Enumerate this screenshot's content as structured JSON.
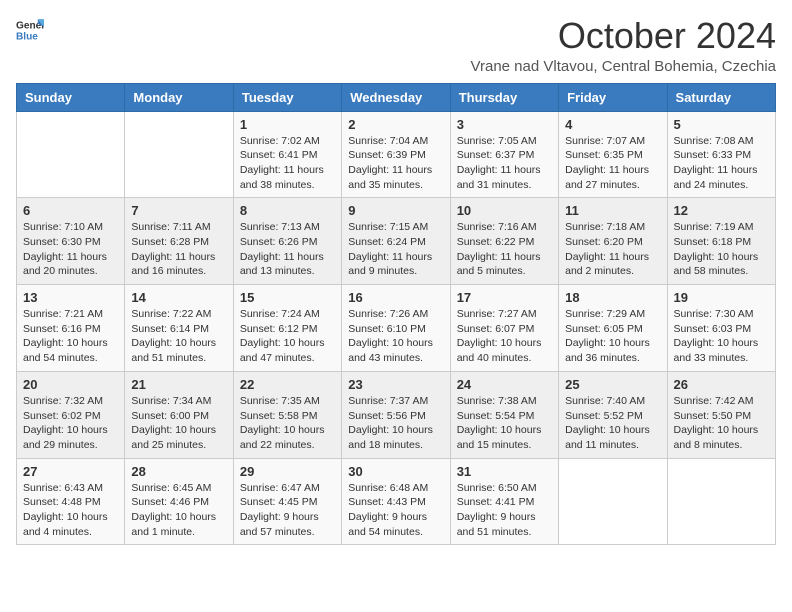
{
  "header": {
    "logo_general": "General",
    "logo_blue": "Blue",
    "month_title": "October 2024",
    "location": "Vrane nad Vltavou, Central Bohemia, Czechia"
  },
  "weekdays": [
    "Sunday",
    "Monday",
    "Tuesday",
    "Wednesday",
    "Thursday",
    "Friday",
    "Saturday"
  ],
  "weeks": [
    [
      {
        "day": "",
        "info": ""
      },
      {
        "day": "",
        "info": ""
      },
      {
        "day": "1",
        "info": "Sunrise: 7:02 AM\nSunset: 6:41 PM\nDaylight: 11 hours and 38 minutes."
      },
      {
        "day": "2",
        "info": "Sunrise: 7:04 AM\nSunset: 6:39 PM\nDaylight: 11 hours and 35 minutes."
      },
      {
        "day": "3",
        "info": "Sunrise: 7:05 AM\nSunset: 6:37 PM\nDaylight: 11 hours and 31 minutes."
      },
      {
        "day": "4",
        "info": "Sunrise: 7:07 AM\nSunset: 6:35 PM\nDaylight: 11 hours and 27 minutes."
      },
      {
        "day": "5",
        "info": "Sunrise: 7:08 AM\nSunset: 6:33 PM\nDaylight: 11 hours and 24 minutes."
      }
    ],
    [
      {
        "day": "6",
        "info": "Sunrise: 7:10 AM\nSunset: 6:30 PM\nDaylight: 11 hours and 20 minutes."
      },
      {
        "day": "7",
        "info": "Sunrise: 7:11 AM\nSunset: 6:28 PM\nDaylight: 11 hours and 16 minutes."
      },
      {
        "day": "8",
        "info": "Sunrise: 7:13 AM\nSunset: 6:26 PM\nDaylight: 11 hours and 13 minutes."
      },
      {
        "day": "9",
        "info": "Sunrise: 7:15 AM\nSunset: 6:24 PM\nDaylight: 11 hours and 9 minutes."
      },
      {
        "day": "10",
        "info": "Sunrise: 7:16 AM\nSunset: 6:22 PM\nDaylight: 11 hours and 5 minutes."
      },
      {
        "day": "11",
        "info": "Sunrise: 7:18 AM\nSunset: 6:20 PM\nDaylight: 11 hours and 2 minutes."
      },
      {
        "day": "12",
        "info": "Sunrise: 7:19 AM\nSunset: 6:18 PM\nDaylight: 10 hours and 58 minutes."
      }
    ],
    [
      {
        "day": "13",
        "info": "Sunrise: 7:21 AM\nSunset: 6:16 PM\nDaylight: 10 hours and 54 minutes."
      },
      {
        "day": "14",
        "info": "Sunrise: 7:22 AM\nSunset: 6:14 PM\nDaylight: 10 hours and 51 minutes."
      },
      {
        "day": "15",
        "info": "Sunrise: 7:24 AM\nSunset: 6:12 PM\nDaylight: 10 hours and 47 minutes."
      },
      {
        "day": "16",
        "info": "Sunrise: 7:26 AM\nSunset: 6:10 PM\nDaylight: 10 hours and 43 minutes."
      },
      {
        "day": "17",
        "info": "Sunrise: 7:27 AM\nSunset: 6:07 PM\nDaylight: 10 hours and 40 minutes."
      },
      {
        "day": "18",
        "info": "Sunrise: 7:29 AM\nSunset: 6:05 PM\nDaylight: 10 hours and 36 minutes."
      },
      {
        "day": "19",
        "info": "Sunrise: 7:30 AM\nSunset: 6:03 PM\nDaylight: 10 hours and 33 minutes."
      }
    ],
    [
      {
        "day": "20",
        "info": "Sunrise: 7:32 AM\nSunset: 6:02 PM\nDaylight: 10 hours and 29 minutes."
      },
      {
        "day": "21",
        "info": "Sunrise: 7:34 AM\nSunset: 6:00 PM\nDaylight: 10 hours and 25 minutes."
      },
      {
        "day": "22",
        "info": "Sunrise: 7:35 AM\nSunset: 5:58 PM\nDaylight: 10 hours and 22 minutes."
      },
      {
        "day": "23",
        "info": "Sunrise: 7:37 AM\nSunset: 5:56 PM\nDaylight: 10 hours and 18 minutes."
      },
      {
        "day": "24",
        "info": "Sunrise: 7:38 AM\nSunset: 5:54 PM\nDaylight: 10 hours and 15 minutes."
      },
      {
        "day": "25",
        "info": "Sunrise: 7:40 AM\nSunset: 5:52 PM\nDaylight: 10 hours and 11 minutes."
      },
      {
        "day": "26",
        "info": "Sunrise: 7:42 AM\nSunset: 5:50 PM\nDaylight: 10 hours and 8 minutes."
      }
    ],
    [
      {
        "day": "27",
        "info": "Sunrise: 6:43 AM\nSunset: 4:48 PM\nDaylight: 10 hours and 4 minutes."
      },
      {
        "day": "28",
        "info": "Sunrise: 6:45 AM\nSunset: 4:46 PM\nDaylight: 10 hours and 1 minute."
      },
      {
        "day": "29",
        "info": "Sunrise: 6:47 AM\nSunset: 4:45 PM\nDaylight: 9 hours and 57 minutes."
      },
      {
        "day": "30",
        "info": "Sunrise: 6:48 AM\nSunset: 4:43 PM\nDaylight: 9 hours and 54 minutes."
      },
      {
        "day": "31",
        "info": "Sunrise: 6:50 AM\nSunset: 4:41 PM\nDaylight: 9 hours and 51 minutes."
      },
      {
        "day": "",
        "info": ""
      },
      {
        "day": "",
        "info": ""
      }
    ]
  ]
}
